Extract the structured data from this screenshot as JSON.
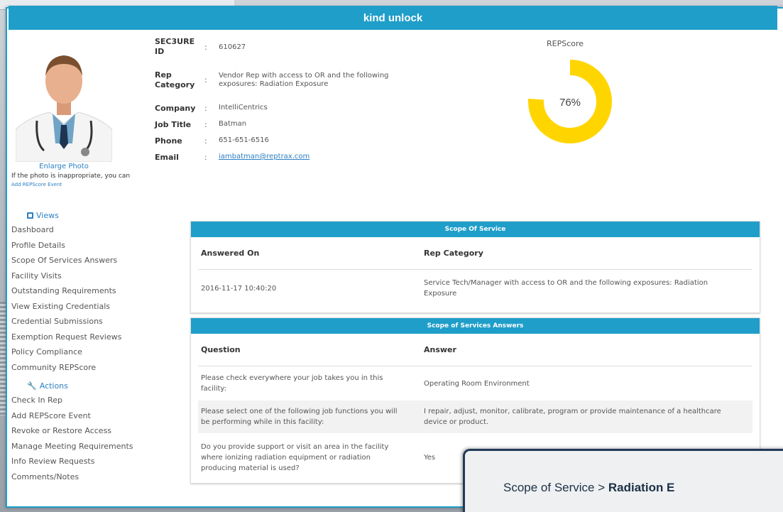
{
  "window": {
    "title": "kind unlock"
  },
  "photo": {
    "enlarge_label": "Enlarge Photo",
    "note_text": "If the photo is inappropriate, you can ",
    "note_link": "Add REPScore Event"
  },
  "profile": {
    "fields": [
      {
        "label": "SEC3URE ID",
        "value": "610627"
      },
      {
        "label": "Rep Category",
        "value": "Vendor Rep with access to OR and the following exposures: Radiation Exposure"
      },
      {
        "label": "Company",
        "value": "IntelliCentrics"
      },
      {
        "label": "Job Title",
        "value": "Batman"
      },
      {
        "label": "Phone",
        "value": "651-651-6516"
      },
      {
        "label": "Email",
        "value": "iambatman@reptrax.com"
      }
    ],
    "separator": ":"
  },
  "repscore": {
    "title": "REPScore",
    "value_text": "76%",
    "value": 76,
    "color": "#ffd500"
  },
  "nav": {
    "views_label": "Views",
    "views": [
      "Dashboard",
      "Profile Details",
      "Scope Of Services Answers",
      "Facility Visits",
      "Outstanding Requirements",
      "View Existing Credentials",
      "Credential Submissions",
      "Exemption Request Reviews",
      "Policy Compliance",
      "Community REPScore"
    ],
    "actions_label": "Actions",
    "actions": [
      "Check In Rep",
      "Add REPScore Event",
      "Revoke or Restore Access",
      "Manage Meeting Requirements",
      "Info Review Requests",
      "Comments/Notes"
    ]
  },
  "scope_of_service": {
    "title": "Scope Of Service",
    "headers": [
      "Answered On",
      "Rep Category"
    ],
    "rows": [
      [
        "2016-11-17 10:40:20",
        "Service Tech/Manager with access to OR and the following exposures: Radiation Exposure"
      ]
    ]
  },
  "scope_answers": {
    "title": "Scope of Services Answers",
    "headers": [
      "Question",
      "Answer"
    ],
    "rows": [
      [
        "Please check everywhere your job takes you in this facility:",
        "Operating Room Environment"
      ],
      [
        "Please select one of the following job functions you will be performing while in this facility:",
        "I repair, adjust, monitor, calibrate, program or provide maintenance of a healthcare device or product."
      ],
      [
        "Do you provide support or visit an area in the facility where ionizing radiation equipment or radiation producing material is used?",
        "Yes"
      ]
    ]
  },
  "tooltip": {
    "prefix": "Scope of Service > ",
    "bold": "Radiation E"
  },
  "colors": {
    "accent": "#1f9ec9",
    "link": "#2b7fc4"
  }
}
